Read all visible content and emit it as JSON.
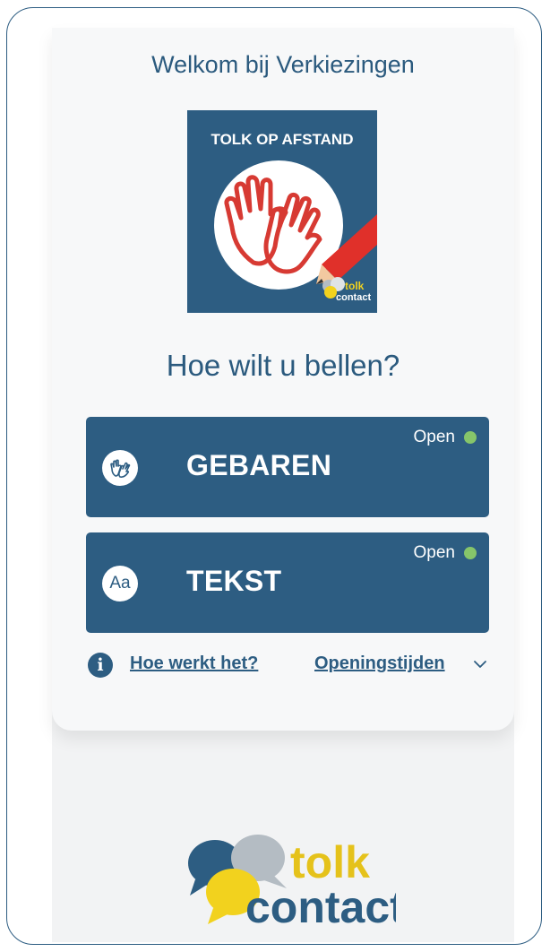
{
  "header": {
    "welcome": "Welkom bij Verkiezingen"
  },
  "logo_tile": {
    "title": "TOLK OP AFSTAND",
    "brand_top": "tolk",
    "brand_bottom": "contact",
    "colors": {
      "background": "#2d5d82",
      "hand_stroke": "#d73a33",
      "pencil": "#e0302a"
    }
  },
  "question": "Hoe wilt u bellen?",
  "options": [
    {
      "label": "GEBAREN",
      "status": "Open",
      "icon": "sign-language-hands-icon"
    },
    {
      "label": "TEKST",
      "status": "Open",
      "icon": "text-aa-icon",
      "icon_text": "Aa"
    }
  ],
  "links": {
    "how_it_works": "Hoe werkt het?",
    "opening_hours": "Openingstijden",
    "chevron": "⌄"
  },
  "footer_logo": {
    "word_top": "tolk",
    "word_bottom": "contact",
    "colors": {
      "blue": "#2d5d82",
      "grey": "#b4bcc3",
      "yellow": "#f2d21e",
      "yellow_text": "#e5c21b"
    }
  },
  "theme": {
    "primary": "#2d5d82",
    "status_open": "#86c56a",
    "background": "#f7f8f9"
  }
}
